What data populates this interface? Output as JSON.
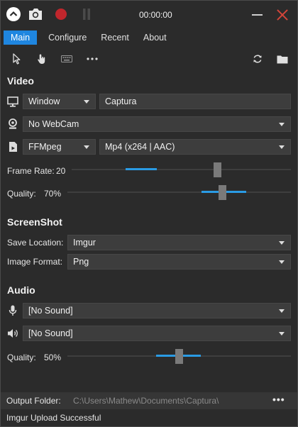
{
  "titlebar": {
    "timer": "00:00:00",
    "icons": [
      "collapse-up-icon",
      "camera-icon",
      "record-icon",
      "pause-icon",
      "minimize-icon",
      "close-icon"
    ]
  },
  "tabs": [
    {
      "label": "Main",
      "active": true
    },
    {
      "label": "Configure",
      "active": false
    },
    {
      "label": "Recent",
      "active": false
    },
    {
      "label": "About",
      "active": false
    }
  ],
  "toolbar": {
    "icons": [
      "cursor-icon",
      "hand-click-icon",
      "keyboard-icon",
      "more-icon",
      "refresh-icon",
      "folder-icon"
    ]
  },
  "video": {
    "heading": "Video",
    "source_type": "Window",
    "source": "Captura",
    "webcam": "No WebCam",
    "encoder": "FFMpeg",
    "codec": "Mp4 (x264 | AAC)",
    "frame_rate_label": "Frame Rate:",
    "frame_rate_value": "20",
    "frame_rate_level": 0.67,
    "quality_label": "Quality:",
    "quality_value": "70%",
    "quality_level": 0.7
  },
  "screenshot": {
    "heading": "ScreenShot",
    "save_location_label": "Save Location:",
    "save_location": "Imgur",
    "image_format_label": "Image Format:",
    "image_format": "Png"
  },
  "audio": {
    "heading": "Audio",
    "microphone": "[No Sound]",
    "speaker": "[No Sound]",
    "quality_label": "Quality:",
    "quality_value": "50%",
    "quality_level": 0.5
  },
  "footer": {
    "output_label": "Output Folder:",
    "output_path": "C:\\Users\\Mathew\\Documents\\Captura\\",
    "more": "•••"
  },
  "status": "Imgur Upload Successful",
  "colors": {
    "accent": "#1f86e0",
    "record": "#c0262c",
    "close": "#d4453a",
    "background": "#2b2b2b"
  }
}
